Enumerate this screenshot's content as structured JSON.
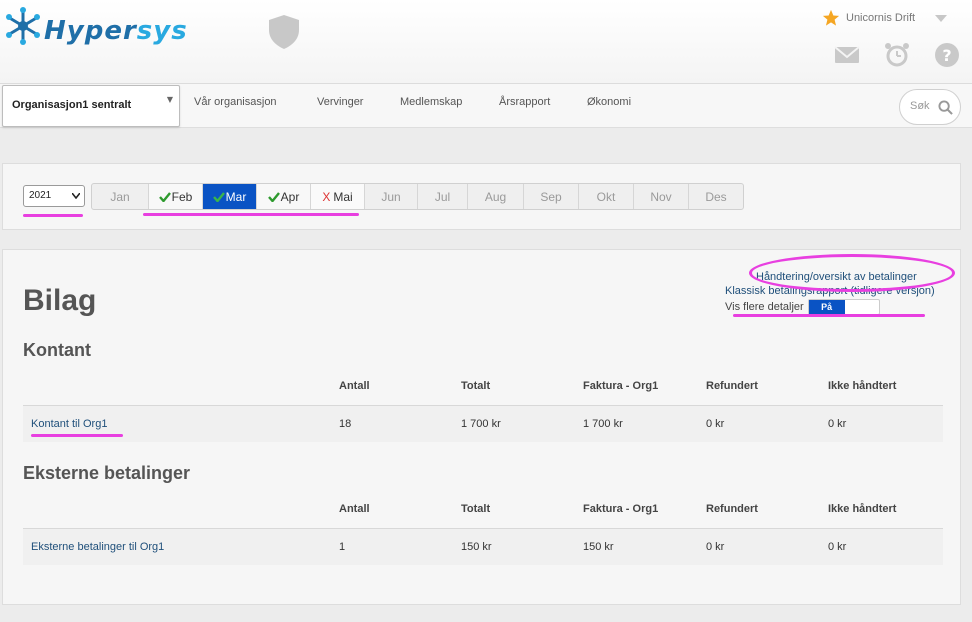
{
  "header": {
    "logo_text_part1": "Hyper",
    "logo_text_part2": "sys",
    "org_drift_label": "Unicornis Drift",
    "icons": [
      "snowflake-logo-icon",
      "shield-icon",
      "star-icon",
      "mail-icon",
      "alarm-icon",
      "help-icon",
      "chevron-down-icon"
    ],
    "accent_color": "#0a53c4",
    "star_color": "#f5a623"
  },
  "nav": {
    "org_selector": "Organisasjon1 sentralt",
    "items": [
      "Vår organisasjon",
      "Vervinger",
      "Medlemskap",
      "Årsrapport",
      "Økonomi"
    ],
    "search_placeholder": "Søk"
  },
  "period": {
    "year": "2021",
    "months": [
      {
        "label": "Jan",
        "status": "inactive"
      },
      {
        "label": "Feb",
        "status": "done"
      },
      {
        "label": "Mar",
        "status": "active"
      },
      {
        "label": "Apr",
        "status": "done"
      },
      {
        "label": "Mai",
        "status": "missing"
      },
      {
        "label": "Jun",
        "status": "inactive"
      },
      {
        "label": "Jul",
        "status": "inactive"
      },
      {
        "label": "Aug",
        "status": "inactive"
      },
      {
        "label": "Sep",
        "status": "inactive"
      },
      {
        "label": "Okt",
        "status": "inactive"
      },
      {
        "label": "Nov",
        "status": "inactive"
      },
      {
        "label": "Des",
        "status": "inactive"
      }
    ]
  },
  "content": {
    "title": "Bilag",
    "link_payments": "Håndtering/oversikt av betalinger",
    "link_classic": "Klassisk betalingsrapport (tidligere versjon)",
    "details_label": "Vis flere detaljer",
    "toggle_label": "På",
    "sections": [
      {
        "title": "Kontant",
        "headers": [
          "",
          "Antall",
          "Totalt",
          "Faktura - Org1",
          "Refundert",
          "Ikke håndtert"
        ],
        "row": [
          "Kontant til Org1",
          "18",
          "1 700 kr",
          "1 700 kr",
          "0 kr",
          "0 kr"
        ]
      },
      {
        "title": "Eksterne betalinger",
        "headers": [
          "",
          "Antall",
          "Totalt",
          "Faktura - Org1",
          "Refundert",
          "Ikke håndtert"
        ],
        "row": [
          "Eksterne betalinger til Org1",
          "1",
          "150 kr",
          "150 kr",
          "0 kr",
          "0 kr"
        ]
      }
    ]
  },
  "annotation_color": "#e83fe0"
}
